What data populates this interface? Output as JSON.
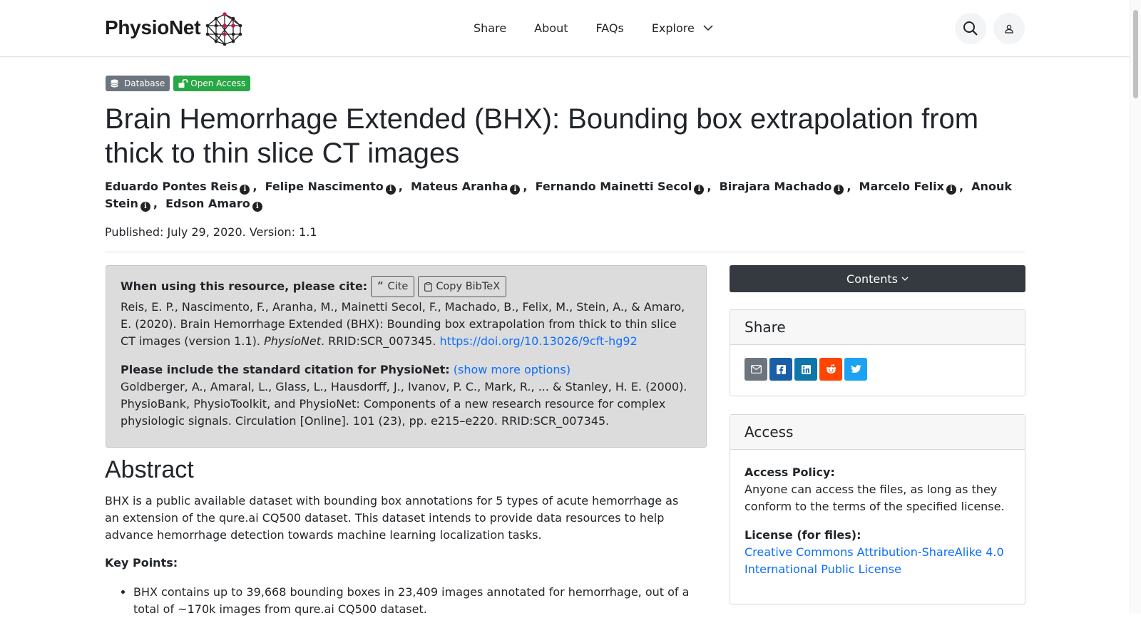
{
  "nav": {
    "logo_text": "PhysioNet",
    "links": [
      "Share",
      "About",
      "FAQs",
      "Explore"
    ]
  },
  "badges": {
    "database": "Database",
    "open_access": "Open Access"
  },
  "title": "Brain Hemorrhage Extended (BHX): Bounding box extrapolation from thick to thin slice CT images",
  "authors": [
    "Eduardo Pontes Reis",
    "Felipe Nascimento",
    "Mateus Aranha",
    "Fernando Mainetti Secol",
    "Birajara Machado",
    "Marcelo Felix",
    "Anouk Stein",
    "Edson Amaro"
  ],
  "published": "Published: July 29, 2020. Version: 1.1",
  "cite": {
    "heading": "When using this resource, please cite:",
    "cite_button": "Cite",
    "bibtex_button": "Copy BibTeX",
    "text_before": "Reis, E. P., Nascimento, F., Aranha, M., Mainetti Secol, F., Machado, B., Felix, M., Stein, A., & Amaro, E. (2020). Brain Hemorrhage Extended (BHX): Bounding box extrapolation from thick to thin slice CT images (version 1.1). ",
    "journal": "PhysioNet",
    "text_after": ". RRID:SCR_007345. ",
    "doi": "https://doi.org/10.13026/9cft-hg92",
    "std_heading": "Please include the standard citation for PhysioNet:",
    "show_more": "(show more options)",
    "std_text": "Goldberger, A., Amaral, L., Glass, L., Hausdorff, J., Ivanov, P. C., Mark, R., ... & Stanley, H. E. (2000). PhysioBank, PhysioToolkit, and PhysioNet: Components of a new research resource for complex physiologic signals. Circulation [Online]. 101 (23), pp. e215–e220. RRID:SCR_007345."
  },
  "abstract": {
    "heading": "Abstract",
    "text": "BHX is a public available dataset with bounding box annotations for 5 types of acute hemorrhage as an extension of the qure.ai CQ500 dataset. This dataset intends to provide data resources to help advance hemorrhage detection towards machine learning localization tasks.",
    "key_points_heading": "Key Points:",
    "key_points": [
      "BHX contains up to 39,668 bounding boxes in 23,409 images annotated for hemorrhage, out of a total of ~170k images from qure.ai CQ500 dataset."
    ]
  },
  "sidebar": {
    "contents_button": "Contents",
    "share_heading": "Share",
    "share_buttons": [
      "email-icon",
      "facebook-icon",
      "linkedin-icon",
      "reddit-icon",
      "twitter-icon"
    ],
    "access_heading": "Access",
    "access_policy_label": "Access Policy:",
    "access_policy_text": "Anyone can access the files, as long as they conform to the terms of the specified license.",
    "license_label": "License (for files):",
    "license_link": "Creative Commons Attribution-ShareAlike 4.0 International Public License"
  },
  "colors": {
    "badge_database": "#6c757d",
    "badge_open_access": "#28a745",
    "link": "#0d6efd",
    "contents_bg": "#343a40",
    "email": "#6c757d",
    "facebook": "#1b5ea8",
    "linkedin": "#0e76a8",
    "reddit": "#ff4500",
    "twitter": "#1da1f2"
  }
}
